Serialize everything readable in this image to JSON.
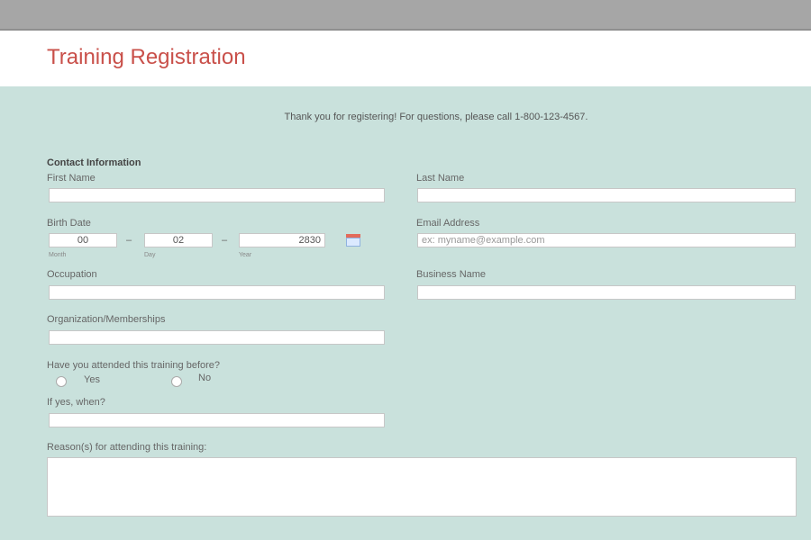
{
  "header": {
    "title": "Training Registration"
  },
  "notice": "Thank you for registering! For questions, please call 1-800-123-4567.",
  "contact": {
    "section_title": "Contact Information",
    "first_name_label": "First Name",
    "last_name_label": "Last Name",
    "birth_date": {
      "label": "Birth Date",
      "month_value": "00",
      "day_value": "02",
      "year_value": "2830",
      "month_label": "Month",
      "day_label": "Day",
      "year_label": "Year",
      "separator": "–"
    },
    "email": {
      "label": "Email Address",
      "placeholder": "ex: myname@example.com"
    },
    "occupation_label": "Occupation",
    "business_name_label": "Business Name",
    "organization_label": "Organization/Memberships",
    "attended_question": "Have you attended this training before?",
    "attended_options": [
      "Yes",
      "No"
    ],
    "if_yes_label": "If yes, when?",
    "reasons_label": "Reason(s) for attending this training:"
  },
  "colors": {
    "title": "#c9504a",
    "background": "#c9e1dc",
    "topbar": "#a6a6a6"
  }
}
